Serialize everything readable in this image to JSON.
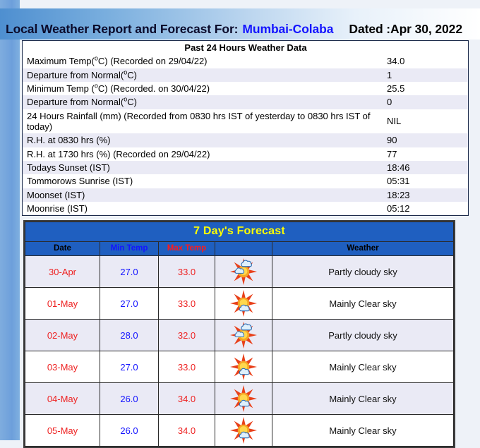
{
  "header": {
    "title_main": "Local Weather Report and Forecast For:",
    "city": "Mumbai-Colaba",
    "dated": "Dated :Apr 30, 2022"
  },
  "past24": {
    "heading": "Past 24 Hours Weather Data",
    "rows": [
      {
        "label_pre": "Maximum Temp(",
        "label_post": "C) (Recorded on 29/04/22)",
        "deg": "o",
        "value": "34.0"
      },
      {
        "label_pre": "Departure from Normal(",
        "label_post": "C)",
        "deg": "o",
        "value": "1"
      },
      {
        "label_pre": "Minimum Temp (",
        "label_post": "C) (Recorded. on 30/04/22)",
        "deg": "o",
        "value": "25.5"
      },
      {
        "label_pre": "Departure from Normal(",
        "label_post": "C)",
        "deg": "o",
        "value": "0"
      },
      {
        "label_pre": "24 Hours Rainfall (mm) (Recorded from 0830 hrs IST of yesterday to 0830 hrs IST of today)",
        "label_post": "",
        "deg": "",
        "value": "NIL"
      },
      {
        "label_pre": "R.H. at 0830 hrs (%)",
        "label_post": "",
        "deg": "",
        "value": "90"
      },
      {
        "label_pre": "R.H. at 1730 hrs (%) (Recorded on 29/04/22)",
        "label_post": "",
        "deg": "",
        "value": "77"
      },
      {
        "label_pre": "Todays Sunset (IST)",
        "label_post": "",
        "deg": "",
        "value": "18:46"
      },
      {
        "label_pre": "Tommorows Sunrise (IST)",
        "label_post": "",
        "deg": "",
        "value": "05:31"
      },
      {
        "label_pre": "Moonset (IST)",
        "label_post": "",
        "deg": "",
        "value": "18:23"
      },
      {
        "label_pre": "Moonrise (IST)",
        "label_post": "",
        "deg": "",
        "value": "05:12"
      }
    ]
  },
  "forecast": {
    "title": "7 Day's Forecast",
    "columns": {
      "date": "Date",
      "min": "Min Temp",
      "max": "Max Temp",
      "weather": "Weather"
    },
    "rows": [
      {
        "date": "30-Apr",
        "min": "27.0",
        "max": "33.0",
        "icon": "sun-behind-cloud-icon",
        "weather": "Partly cloudy sky"
      },
      {
        "date": "01-May",
        "min": "27.0",
        "max": "33.0",
        "icon": "sun-with-small-cloud-icon",
        "weather": "Mainly Clear sky"
      },
      {
        "date": "02-May",
        "min": "28.0",
        "max": "32.0",
        "icon": "sun-behind-cloud-icon",
        "weather": "Partly cloudy sky"
      },
      {
        "date": "03-May",
        "min": "27.0",
        "max": "33.0",
        "icon": "sun-with-small-cloud-icon",
        "weather": "Mainly Clear sky"
      },
      {
        "date": "04-May",
        "min": "26.0",
        "max": "34.0",
        "icon": "sun-with-small-cloud-icon",
        "weather": "Mainly Clear sky"
      },
      {
        "date": "05-May",
        "min": "26.0",
        "max": "34.0",
        "icon": "sun-with-small-cloud-icon",
        "weather": "Mainly Clear sky"
      }
    ]
  },
  "colors": {
    "banner_blue": "#4e8fd0",
    "side_strip_blue": "#6d9fdb",
    "table_header_blue": "#1f5fc0",
    "title_yellow": "#ffff00",
    "min_temp_blue": "#1414ff",
    "max_temp_red": "#ee2222",
    "row_tint": "#eaeaf5"
  }
}
